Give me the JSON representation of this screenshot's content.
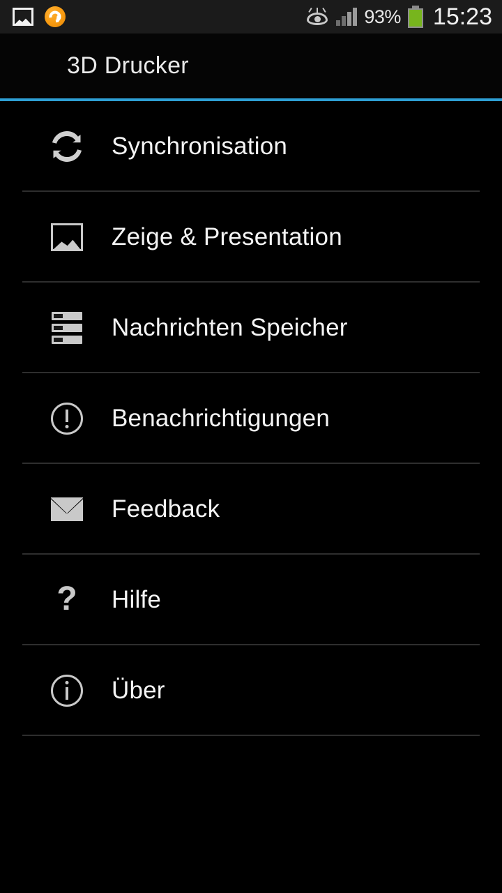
{
  "status_bar": {
    "left_icons": [
      "photo-icon",
      "app-orange-icon"
    ],
    "smart_stay_icon": "eye-icon",
    "signal_icon": "signal-bars-icon",
    "battery_percent": "93%",
    "battery_icon": "battery-icon",
    "clock": "15:23"
  },
  "action_bar": {
    "title": "3D Drucker",
    "accent_color": "#2e9fd4"
  },
  "menu": {
    "items": [
      {
        "label": "Synchronisation",
        "icon": "sync-icon"
      },
      {
        "label": "Zeige & Presentation",
        "icon": "photo-icon"
      },
      {
        "label": "Nachrichten Speicher",
        "icon": "storage-icon"
      },
      {
        "label": "Benachrichtigungen",
        "icon": "alert-circle-icon"
      },
      {
        "label": "Feedback",
        "icon": "mail-icon"
      },
      {
        "label": "Hilfe",
        "icon": "question-mark-icon"
      },
      {
        "label": "Über",
        "icon": "info-circle-icon"
      }
    ]
  },
  "colors": {
    "background": "#000000",
    "status_bar_background": "#1b1b1b",
    "accent": "#2e9fd4",
    "text_primary": "#f4f4f4",
    "icon": "#c9c9c9",
    "divider": "#2e2e2e",
    "battery_green": "#77b51d",
    "app_icon_orange": "#f79a10"
  },
  "glyphs": {
    "question_mark": "?"
  }
}
